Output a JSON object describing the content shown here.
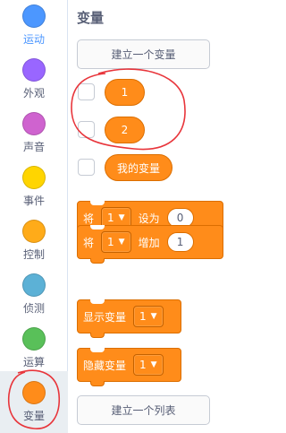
{
  "categories": [
    {
      "label": "运动",
      "color": "#4c97ff"
    },
    {
      "label": "外观",
      "color": "#9966ff"
    },
    {
      "label": "声音",
      "color": "#cf63cf"
    },
    {
      "label": "事件",
      "color": "#ffd500"
    },
    {
      "label": "控制",
      "color": "#ffab19"
    },
    {
      "label": "侦测",
      "color": "#5cb1d6"
    },
    {
      "label": "运算",
      "color": "#59c059"
    },
    {
      "label": "变量",
      "color": "#ff8c1a"
    }
  ],
  "palette": {
    "title": "变量",
    "make_variable_button": "建立一个变量",
    "variables": [
      {
        "name": "1"
      },
      {
        "name": "2"
      },
      {
        "name": "我的变量"
      }
    ],
    "set_block": {
      "label": "将",
      "var": "1",
      "op": "设为",
      "value": "0"
    },
    "change_block": {
      "label": "将",
      "var": "1",
      "op": "增加",
      "value": "1"
    },
    "show_block": {
      "label": "显示变量",
      "var": "1"
    },
    "hide_block": {
      "label": "隐藏变量",
      "var": "1"
    },
    "make_list_button": "建立一个列表"
  },
  "colors": {
    "variables": "#ff8c1a",
    "annotation": "#e8353b",
    "active_category": "#4c97ff"
  }
}
